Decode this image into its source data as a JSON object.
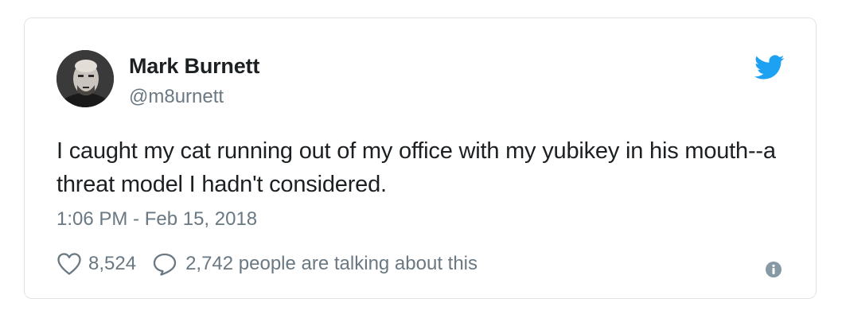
{
  "tweet": {
    "author_name": "Mark Burnett",
    "author_handle": "@m8urnett",
    "text": "I caught my cat running out of my office with my yubikey in his mouth--a threat model I hadn't considered.",
    "timestamp": "1:06 PM - Feb 15, 2018",
    "likes": "8,524",
    "talking": "2,742 people are talking about this"
  },
  "icons": {
    "logo": "twitter-bird-icon",
    "like": "heart-icon",
    "reply": "speech-bubble-icon",
    "info": "info-icon"
  },
  "colors": {
    "text": "#1c2022",
    "secondary": "#697882",
    "twitter_blue": "#1da1f2",
    "border": "#dfe3e8"
  }
}
